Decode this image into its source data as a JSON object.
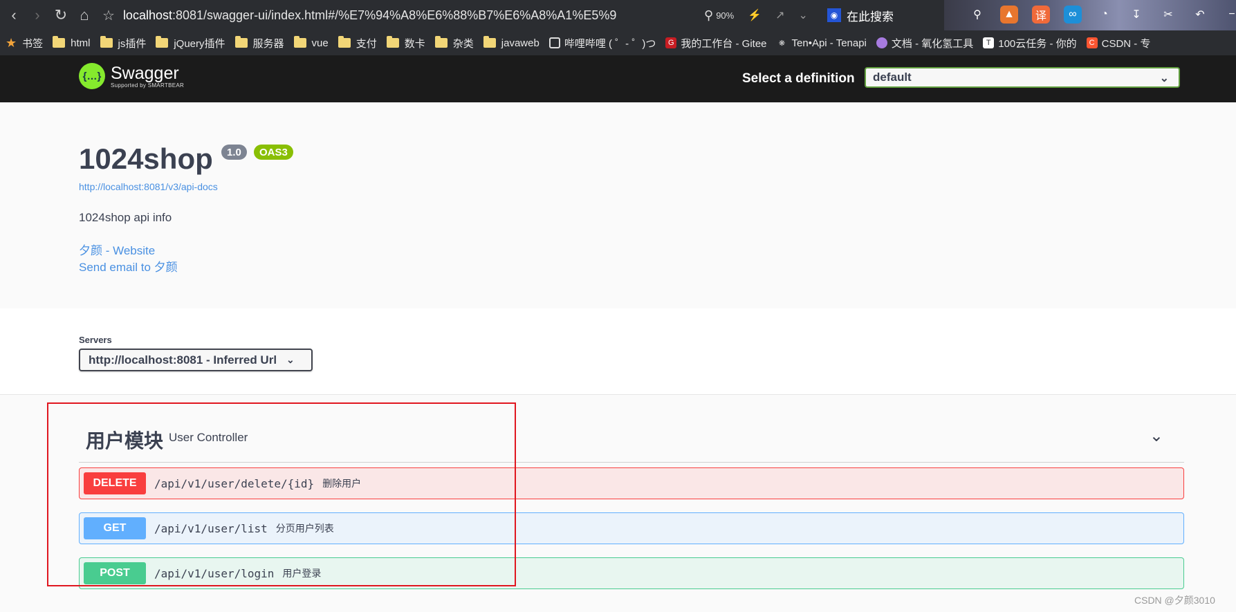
{
  "browser": {
    "url_host": "localhost",
    "url_rest": ":8081/swagger-ui/index.html#/%E7%94%A8%E6%88%B7%E6%A8%A1%E5%9",
    "zoom": "90%",
    "search_placeholder": "在此搜索",
    "bookmarks": [
      {
        "label": "书签",
        "icon": "star-icon"
      },
      {
        "label": "html",
        "icon": "folder-icon"
      },
      {
        "label": "js插件",
        "icon": "folder-icon"
      },
      {
        "label": "jQuery插件",
        "icon": "folder-icon"
      },
      {
        "label": "服务器",
        "icon": "folder-icon"
      },
      {
        "label": "vue",
        "icon": "folder-icon"
      },
      {
        "label": "支付",
        "icon": "folder-icon"
      },
      {
        "label": "数卡",
        "icon": "folder-icon"
      },
      {
        "label": "杂类",
        "icon": "folder-icon"
      },
      {
        "label": "javaweb",
        "icon": "folder-icon"
      },
      {
        "label": "哔哩哔哩 ( ゜- ゜)つ",
        "icon": "bilibili-icon"
      },
      {
        "label": "我的工作台 - Gitee",
        "icon": "gitee-icon"
      },
      {
        "label": "Ten•Api - Tenapi",
        "icon": "share-icon"
      },
      {
        "label": "文档 - 氧化氢工具",
        "icon": "doc-icon"
      },
      {
        "label": "100云任务 - 你的",
        "icon": "task-icon"
      },
      {
        "label": "CSDN - 专",
        "icon": "csdn-icon"
      }
    ]
  },
  "topbar": {
    "logo_name": "Swagger",
    "logo_sub": "Supported by SMARTBEAR",
    "definition_label": "Select a definition",
    "definition_value": "default"
  },
  "info": {
    "title": "1024shop",
    "version": "1.0",
    "oas": "OAS3",
    "api_docs_url": "http://localhost:8081/v3/api-docs",
    "description": "1024shop api info",
    "website_link": "夕颜 - Website",
    "email_link": "Send email to 夕颜"
  },
  "servers": {
    "label": "Servers",
    "selected": "http://localhost:8081 - Inferred Url"
  },
  "tag": {
    "name": "用户模块",
    "description": "User Controller"
  },
  "operations": [
    {
      "method": "DELETE",
      "path": "/api/v1/user/delete/{id}",
      "summary": "删除用户"
    },
    {
      "method": "GET",
      "path": "/api/v1/user/list",
      "summary": "分页用户列表"
    },
    {
      "method": "POST",
      "path": "/api/v1/user/login",
      "summary": "用户登录"
    }
  ],
  "watermark": "CSDN @夕颜3010",
  "colors": {
    "delete": "#f93e3e",
    "get": "#61affe",
    "post": "#49cc90",
    "link": "#4990e2",
    "highlight_box": "#e0161f"
  }
}
